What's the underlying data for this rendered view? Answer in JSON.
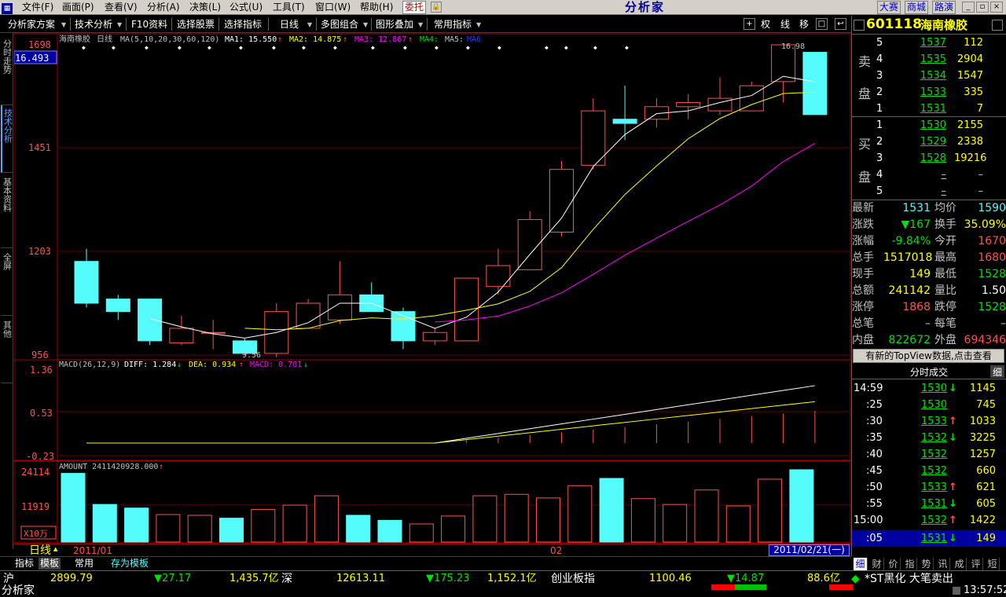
{
  "menubar": {
    "items": [
      "文件(F)",
      "画面(P)",
      "查看(V)",
      "分析(A)",
      "决策(L)",
      "公式(U)",
      "工具(T)",
      "窗口(W)",
      "帮助(H)"
    ],
    "trust": "委托",
    "brand": "分析家",
    "buttons": [
      "大赛",
      "商城",
      "路演"
    ]
  },
  "toolbar": {
    "items": [
      "分析家方案",
      "技术分析",
      "F10资料",
      "选择股票",
      "选择指标",
      "日线",
      "多图组合",
      "图形叠加",
      "常用指标"
    ],
    "icons": [
      "权",
      "线",
      "移"
    ]
  },
  "left_tabs": [
    "分时走势",
    "技术分析",
    "基本资料",
    "全屏",
    "其他"
  ],
  "stock": {
    "code": "601118",
    "name": "海南橡胶"
  },
  "main_chart": {
    "title": "海南橡胶",
    "period": "日线",
    "ma_params": "MA(5,10,20,30,60,120)",
    "ma1": "MA1: 15.550",
    "ma2": "MA2: 14.875",
    "ma3": "MA3: 12.867",
    "ma4": "MA4:",
    "ma5": "MA5:",
    "ma6": "MA6",
    "cursor_value": "16.493",
    "y_labels": [
      "1698",
      "1451",
      "1203",
      "956"
    ],
    "high_label": "16.98",
    "low_label": "9.56"
  },
  "macd": {
    "title": "MACD(26,12,9)",
    "diff": "DIFF: 1.284",
    "dea": "DEA: 0.934",
    "macd_val": "MACD: 0.701",
    "y_labels": [
      "1.36",
      "0.53",
      "-0.23"
    ]
  },
  "amount": {
    "title": "AMOUNT 2411420928.000",
    "y_labels": [
      "24114",
      "11919"
    ],
    "unit": "X10万"
  },
  "x_axis": {
    "period": "日线",
    "labels": [
      "2011/01",
      "02"
    ],
    "date_box": "2011/02/21(一)"
  },
  "chart_data": [
    {
      "type": "candlestick",
      "title": "海南橡胶",
      "series": [
        {
          "name": "MA1",
          "value": 15.55
        },
        {
          "name": "MA2",
          "value": 14.875
        },
        {
          "name": "MA3",
          "value": 12.867
        }
      ],
      "ylim": [
        9.56,
        16.98
      ],
      "candles": [
        {
          "o": 11.8,
          "c": 10.8,
          "h": 12.1,
          "l": 10.7
        },
        {
          "o": 10.9,
          "c": 10.6,
          "h": 11.0,
          "l": 10.4
        },
        {
          "o": 10.9,
          "c": 9.9,
          "h": 10.9,
          "l": 9.8
        },
        {
          "o": 9.85,
          "c": 10.2,
          "h": 10.5,
          "l": 9.8
        },
        {
          "o": 10.1,
          "c": 10.1,
          "h": 10.4,
          "l": 9.7
        },
        {
          "o": 9.9,
          "c": 9.6,
          "h": 9.95,
          "l": 9.56
        },
        {
          "o": 9.6,
          "c": 10.6,
          "h": 10.8,
          "l": 9.5
        },
        {
          "o": 10.2,
          "c": 10.8,
          "h": 10.9,
          "l": 10.2
        },
        {
          "o": 10.4,
          "c": 11.0,
          "h": 11.8,
          "l": 10.3
        },
        {
          "o": 11.0,
          "c": 10.6,
          "h": 11.3,
          "l": 10.6
        },
        {
          "o": 10.6,
          "c": 9.9,
          "h": 10.7,
          "l": 9.7
        },
        {
          "o": 9.9,
          "c": 10.1,
          "h": 10.2,
          "l": 9.8
        },
        {
          "o": 9.9,
          "c": 11.4,
          "h": 11.4,
          "l": 9.9
        },
        {
          "o": 11.2,
          "c": 11.7,
          "h": 12.1,
          "l": 11.0
        },
        {
          "o": 11.6,
          "c": 12.8,
          "h": 13.0,
          "l": 11.6
        },
        {
          "o": 12.5,
          "c": 14.0,
          "h": 14.2,
          "l": 12.4
        },
        {
          "o": 14.1,
          "c": 15.4,
          "h": 15.7,
          "l": 14.0
        },
        {
          "o": 15.2,
          "c": 15.1,
          "h": 16.0,
          "l": 14.7
        },
        {
          "o": 15.2,
          "c": 15.5,
          "h": 15.7,
          "l": 15.0
        },
        {
          "o": 15.5,
          "c": 15.6,
          "h": 15.8,
          "l": 15.2
        },
        {
          "o": 15.4,
          "c": 15.7,
          "h": 16.2,
          "l": 15.3
        },
        {
          "o": 15.4,
          "c": 16.0,
          "h": 16.1,
          "l": 15.4
        },
        {
          "o": 16.1,
          "c": 16.98,
          "h": 16.98,
          "l": 15.6
        },
        {
          "o": 16.8,
          "c": 15.31,
          "h": 16.8,
          "l": 15.31
        }
      ]
    }
  ],
  "orderbook": {
    "sell_label_top": "卖",
    "sell_label_bot": "盘",
    "buy_label_top": "买",
    "buy_label_bot": "盘",
    "sell": [
      {
        "lvl": "5",
        "price": "1537",
        "vol": "112"
      },
      {
        "lvl": "4",
        "price": "1535",
        "vol": "2904"
      },
      {
        "lvl": "3",
        "price": "1534",
        "vol": "1547"
      },
      {
        "lvl": "2",
        "price": "1533",
        "vol": "335"
      },
      {
        "lvl": "1",
        "price": "1531",
        "vol": "7"
      }
    ],
    "buy": [
      {
        "lvl": "1",
        "price": "1530",
        "vol": "2155"
      },
      {
        "lvl": "2",
        "price": "1529",
        "vol": "2338"
      },
      {
        "lvl": "3",
        "price": "1528",
        "vol": "19216"
      },
      {
        "lvl": "4",
        "price": "–",
        "vol": "–"
      },
      {
        "lvl": "5",
        "price": "–",
        "vol": "–"
      }
    ]
  },
  "stats": [
    {
      "l1": "最新",
      "v1": "1531",
      "l2": "均价",
      "v2": "1590"
    },
    {
      "l1": "涨跌",
      "v1": "▼167",
      "l2": "换手",
      "v2": "35.09%"
    },
    {
      "l1": "涨幅",
      "v1": "-9.84%",
      "l2": "今开",
      "v2": "1670"
    },
    {
      "l1": "总手",
      "v1": "1517018",
      "l2": "最高",
      "v2": "1680"
    },
    {
      "l1": "现手",
      "v1": "149",
      "l2": "最低",
      "v2": "1528"
    },
    {
      "l1": "总额",
      "v1": "241142",
      "l2": "量比",
      "v2": "1.50"
    },
    {
      "l1": "涨停",
      "v1": "1868",
      "l2": "跌停",
      "v2": "1528"
    },
    {
      "l1": "总笔",
      "v1": "–",
      "l2": "每笔",
      "v2": "–"
    },
    {
      "l1": "内盘",
      "v1": "822672",
      "l2": "外盘",
      "v2": "694346"
    }
  ],
  "topview": "有新的TopView数据,点击查看",
  "trades_header": {
    "title": "分时成交",
    "detail": "细"
  },
  "trades": [
    {
      "t": "14:59",
      "p": "1530",
      "a": "↓",
      "v": "1145"
    },
    {
      "t": ":25",
      "p": "1530",
      "a": "",
      "v": "745"
    },
    {
      "t": ":30",
      "p": "1533",
      "a": "↑",
      "v": "1033"
    },
    {
      "t": ":35",
      "p": "1532",
      "a": "↓",
      "v": "3225"
    },
    {
      "t": ":40",
      "p": "1532",
      "a": "",
      "v": "1257"
    },
    {
      "t": ":45",
      "p": "1532",
      "a": "",
      "v": "660"
    },
    {
      "t": ":50",
      "p": "1533",
      "a": "↑",
      "v": "621"
    },
    {
      "t": ":55",
      "p": "1531",
      "a": "↓",
      "v": "605"
    },
    {
      "t": "15:00",
      "p": "1532",
      "a": "↑",
      "v": "1422"
    },
    {
      "t": ":05",
      "p": "1531",
      "a": "↓",
      "v": "149"
    }
  ],
  "right_tabs": [
    "细",
    "财",
    "价",
    "指",
    "势",
    "讯",
    "成",
    "评",
    "短"
  ],
  "bottom_tabs": [
    "指标",
    "模板",
    "常用",
    "存为模板"
  ],
  "status": {
    "market1": "沪",
    "idx1": "2899.79",
    "chg1": "▼27.17",
    "amt1": "1,435.7亿",
    "market2": "深",
    "idx2": "12613.11",
    "chg2": "▼175.23",
    "amt2": "1,152.1亿",
    "market3": "创业板指",
    "idx3": "1100.46",
    "chg3": "▼14.87",
    "amt3": "88.6亿",
    "news": "*ST黑化 大笔卖出",
    "brand": "分析家",
    "time": "13:57:52"
  },
  "colors": {
    "up": "#ff5050",
    "down": "#54fcfc",
    "yellow": "#ffff00",
    "green": "#00e000",
    "white": "#ffffff",
    "magenta": "#ff00ff"
  }
}
